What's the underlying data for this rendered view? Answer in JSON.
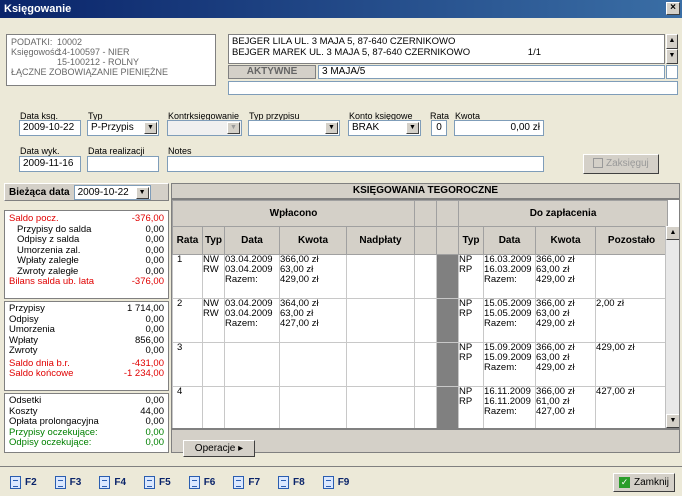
{
  "window": {
    "title": "Księgowanie",
    "close": "×"
  },
  "info": {
    "podatki_label": "PODATKI:",
    "podatki_value": "10002",
    "ksiegowosc_label": "Księgowość:",
    "ksiegowosc_line1": "14-100597  - NIER",
    "ksiegowosc_line2": "15-100212  - ROLNY",
    "zobowiazanie": "ŁĄCZNE ZOBOWIĄZANIE PIENIĘŻNE"
  },
  "persons": {
    "line1": "BEJGER LILA UL. 3 MAJA 5, 87-640 CZERNIKOWO",
    "line2": "BEJGER MAREK UL. 3 MAJA 5, 87-640 CZERNIKOWO",
    "page": "1/1",
    "status": "AKTYWNE",
    "address": "3 MAJA/5"
  },
  "form": {
    "data_ksg_label": "Data ksg.",
    "data_ksg": "2009-10-22",
    "typ_label": "Typ",
    "typ": "P-Przypis",
    "kontrksieg_label": "Kontrksięgowanie",
    "kontrksieg": "",
    "typ_przypisu_label": "Typ przypisu",
    "typ_przypisu": "",
    "konto_label": "Konto księgowe",
    "konto": "BRAK",
    "rata_label": "Rata",
    "rata": "0",
    "kwota_label": "Kwota",
    "kwota": "0,00 zł",
    "data_wyk_label": "Data wyk.",
    "data_wyk": "2009-11-16",
    "data_real_label": "Data realizacji",
    "data_real": "",
    "notes_label": "Notes",
    "notes": "",
    "zaksieguj": "Zaksięguj"
  },
  "summary": {
    "biezaca_label": "Bieżąca data",
    "biezaca": "2009-10-22",
    "group1": [
      {
        "label": "Saldo pocz.",
        "value": "-376,00",
        "color": "red",
        "indent": false
      },
      {
        "label": "Przypisy do salda",
        "value": "0,00",
        "color": "black",
        "indent": true
      },
      {
        "label": "Odpisy z salda",
        "value": "0,00",
        "color": "black",
        "indent": true
      },
      {
        "label": "Umorzenia zal.",
        "value": "0,00",
        "color": "black",
        "indent": true
      },
      {
        "label": "Wpłaty zaległe",
        "value": "0,00",
        "color": "black",
        "indent": true
      },
      {
        "label": "Zwroty zaległe",
        "value": "0,00",
        "color": "black",
        "indent": true
      },
      {
        "label": "Bilans salda ub. lata",
        "value": "-376,00",
        "color": "red",
        "indent": false
      }
    ],
    "group2": [
      {
        "label": "Przypisy",
        "value": "1 714,00",
        "color": "black"
      },
      {
        "label": "Odpisy",
        "value": "0,00",
        "color": "black"
      },
      {
        "label": "Umorzenia",
        "value": "0,00",
        "color": "black"
      },
      {
        "label": "Wpłaty",
        "value": "856,00",
        "color": "black"
      },
      {
        "label": "Zwroty",
        "value": "0,00",
        "color": "black"
      },
      {
        "label": "Saldo dnia b.r.",
        "value": "-431,00",
        "color": "red"
      },
      {
        "label": "Saldo końcowe",
        "value": "-1 234,00",
        "color": "red"
      }
    ],
    "group3": [
      {
        "label": "Odsetki",
        "value": "0,00",
        "color": "black"
      },
      {
        "label": "Koszty",
        "value": "44,00",
        "color": "black"
      },
      {
        "label": "Opłata prolongacyjna",
        "value": "0,00",
        "color": "black"
      },
      {
        "label": "Przypisy oczekujące:",
        "value": "0,00",
        "color": "green"
      },
      {
        "label": "Odpisy oczekujące:",
        "value": "0,00",
        "color": "green"
      }
    ]
  },
  "grid": {
    "title": "KSIĘGOWANIA TEGOROCZNE",
    "wplacono": "Wpłacono",
    "do_zaplacenia": "Do zapłacenia",
    "cols": {
      "rata": "Rata",
      "typ": "Typ",
      "data": "Data",
      "kwota": "Kwota",
      "nadplaty": "Nadpłaty",
      "typ2": "Typ",
      "data2": "Data",
      "kwota2": "Kwota",
      "pozostalo": "Pozostało"
    },
    "rows": [
      {
        "rata": "1",
        "typ": [
          "NW",
          "RW"
        ],
        "data": [
          "03.04.2009",
          "03.04.2009",
          "Razem:"
        ],
        "kwota": [
          "366,00 zł",
          "63,00 zł",
          "429,00 zł"
        ],
        "typ2": [
          "NP",
          "RP"
        ],
        "data2": [
          "16.03.2009",
          "16.03.2009",
          "Razem:"
        ],
        "kwota2": [
          "366,00 zł",
          "63,00 zł",
          "429,00 zł"
        ],
        "pozostalo": "",
        "red": false
      },
      {
        "rata": "2",
        "typ": [
          "NW",
          "RW"
        ],
        "data": [
          "03.04.2009",
          "03.04.2009",
          "Razem:"
        ],
        "kwota": [
          "364,00 zł",
          "63,00 zł",
          "427,00 zł"
        ],
        "typ2": [
          "NP",
          "RP"
        ],
        "data2": [
          "15.05.2009",
          "15.05.2009",
          "Razem:"
        ],
        "kwota2": [
          "366,00 zł",
          "63,00 zł",
          "429,00 zł"
        ],
        "pozostalo": "2,00 zł",
        "red": true
      },
      {
        "rata": "3",
        "typ": [],
        "data": [],
        "kwota": [],
        "typ2": [
          "NP",
          "RP"
        ],
        "data2": [
          "15.09.2009",
          "15.09.2009",
          "Razem:"
        ],
        "kwota2": [
          "366,00 zł",
          "63,00 zł",
          "429,00 zł"
        ],
        "pozostalo": "429,00 zł",
        "red": true
      },
      {
        "rata": "4",
        "typ": [],
        "data": [],
        "kwota": [],
        "typ2": [
          "NP",
          "RP"
        ],
        "data2": [
          "16.11.2009",
          "16.11.2009",
          "Razem:"
        ],
        "kwota2": [
          "366,00 zł",
          "61,00 zł",
          "427,00 zł"
        ],
        "pozostalo": "427,00 zł",
        "red": false
      }
    ],
    "operacje": "Operacje"
  },
  "fkeys": [
    "F2",
    "F3",
    "F4",
    "F5",
    "F6",
    "F7",
    "F8",
    "F9"
  ],
  "zamknij": "Zamknij"
}
